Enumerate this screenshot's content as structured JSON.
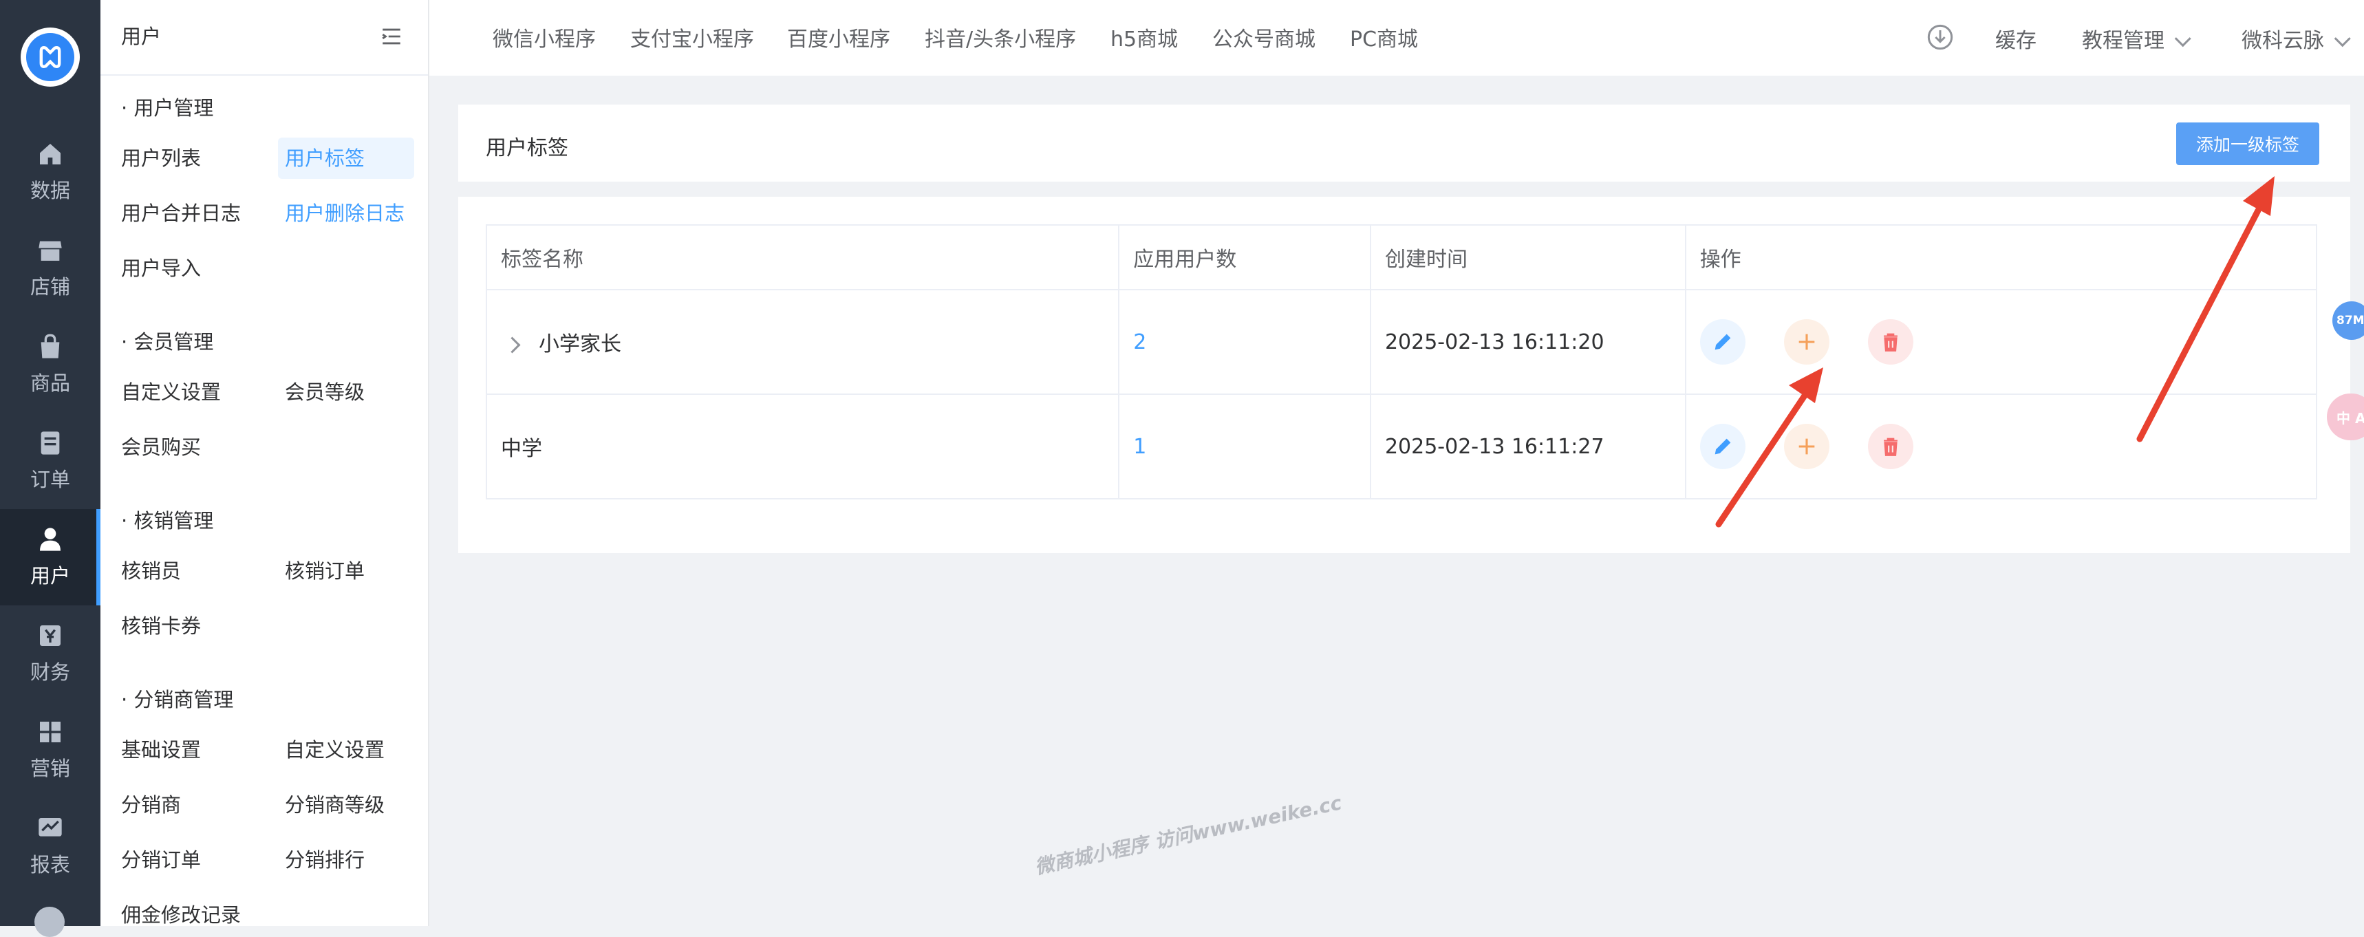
{
  "rail": {
    "items": [
      {
        "label": "数据",
        "icon": "home-icon"
      },
      {
        "label": "店铺",
        "icon": "store-icon"
      },
      {
        "label": "商品",
        "icon": "bag-icon"
      },
      {
        "label": "订单",
        "icon": "order-icon"
      },
      {
        "label": "用户",
        "icon": "user-icon",
        "active": true
      },
      {
        "label": "财务",
        "icon": "finance-icon"
      },
      {
        "label": "营销",
        "icon": "marketing-icon"
      },
      {
        "label": "报表",
        "icon": "report-icon"
      }
    ]
  },
  "submenu": {
    "title": "用户",
    "groups": [
      {
        "title": "· 用户管理",
        "links": [
          "用户列表",
          "用户标签",
          "用户合并日志",
          "用户删除日志",
          "用户导入"
        ]
      },
      {
        "title": "· 会员管理",
        "links": [
          "自定义设置",
          "会员等级",
          "会员购买"
        ]
      },
      {
        "title": "· 核销管理",
        "links": [
          "核销员",
          "核销订单",
          "核销卡券"
        ]
      },
      {
        "title": "· 分销商管理",
        "links": [
          "基础设置",
          "自定义设置",
          "分销商",
          "分销商等级",
          "分销订单",
          "分销排行",
          "佣金修改记录"
        ]
      }
    ]
  },
  "topbar": {
    "tabs": [
      "微信小程序",
      "支付宝小程序",
      "百度小程序",
      "抖音/头条小程序",
      "h5商城",
      "公众号商城",
      "PC商城"
    ],
    "cache": "缓存",
    "tutorial": "教程管理",
    "account": "微科云脉"
  },
  "page": {
    "title": "用户标签",
    "add_button": "添加一级标签"
  },
  "table": {
    "headers": [
      "标签名称",
      "应用用户数",
      "创建时间",
      "操作"
    ],
    "rows": [
      {
        "name": "小学家长",
        "count": "2",
        "created": "2025-02-13 16:11:20",
        "expandable": true
      },
      {
        "name": "中学",
        "count": "1",
        "created": "2025-02-13 16:11:27",
        "expandable": false
      }
    ]
  },
  "overlays": {
    "memory_badge": "87M",
    "lang_badge": "中 A",
    "watermark": "微商城小程序 访问www.weike.cc"
  },
  "colors": {
    "accent": "#409eff",
    "rail": "#2b3441",
    "add": "#f5a05a",
    "delete": "#f56c6c",
    "annotation_arrow": "#e8412f"
  }
}
